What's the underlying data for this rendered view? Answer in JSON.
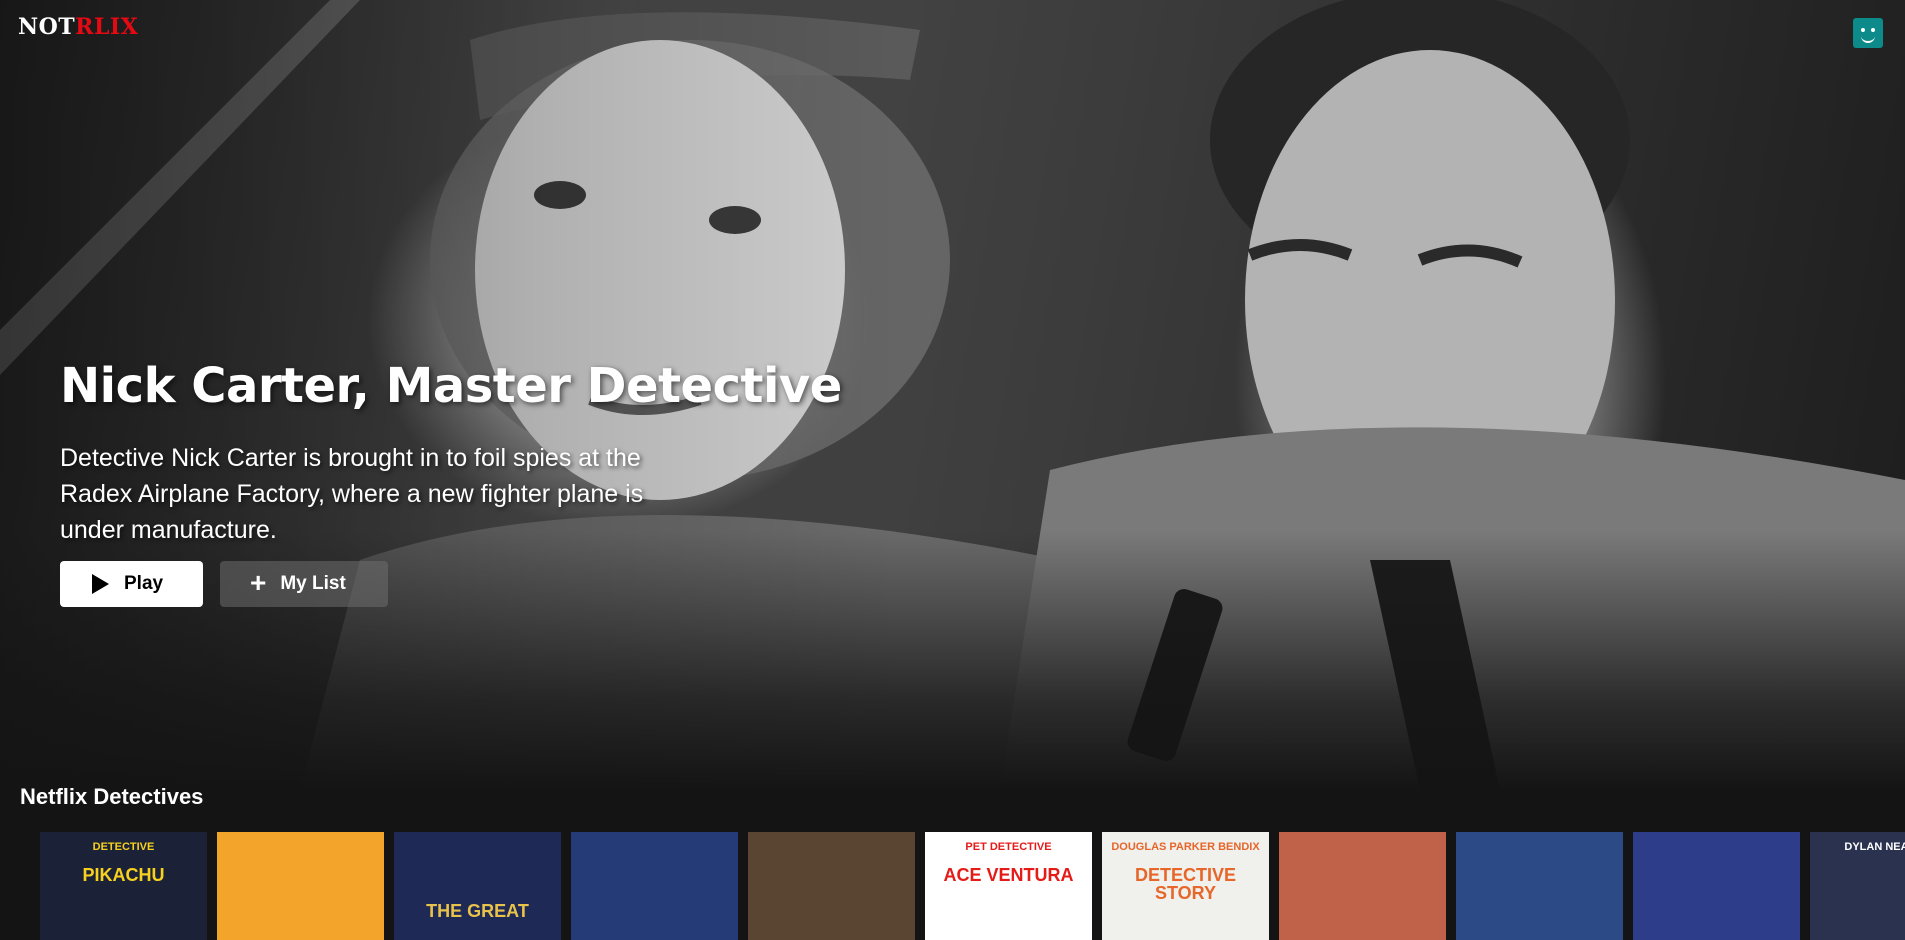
{
  "nav": {
    "logo_white": "NOT",
    "logo_red": "RLIX",
    "avatar_color": "#0d8a8a"
  },
  "hero": {
    "title": "Nick Carter, Master Detective",
    "description": "Detective Nick Carter is brought in to foil spies at the Radex Airplane Factory, where a new fighter plane is under manufacture.",
    "play_label": "Play",
    "mylist_label": "My List"
  },
  "row": {
    "title": "Netflix Detectives",
    "posters": [
      {
        "text": "PIKACHU",
        "sub": "DETECTIVE",
        "bg": "#1b2238",
        "fg": "#f7d11e"
      },
      {
        "text": "",
        "sub": "",
        "bg": "#f2a52a",
        "fg": "#222"
      },
      {
        "text": "THE GREAT",
        "sub": "",
        "bg": "#1e2a55",
        "fg": "#e8c24a"
      },
      {
        "text": "",
        "sub": "",
        "bg": "#243b78",
        "fg": "#fff"
      },
      {
        "text": "",
        "sub": "",
        "bg": "#5a4532",
        "fg": "#fff"
      },
      {
        "text": "ACE VENTURA",
        "sub": "PET DETECTIVE",
        "bg": "#ffffff",
        "fg": "#e41b17"
      },
      {
        "text": "DETECTIVE STORY",
        "sub": "DOUGLAS PARKER BENDIX",
        "bg": "#f0f0ec",
        "fg": "#e7662a"
      },
      {
        "text": "",
        "sub": "",
        "bg": "#c0614a",
        "fg": "#fff"
      },
      {
        "text": "",
        "sub": "",
        "bg": "#2b4a86",
        "fg": "#fff"
      },
      {
        "text": "",
        "sub": "",
        "bg": "#2d3d8a",
        "fg": "#fff"
      },
      {
        "text": "",
        "sub": "DYLAN NEAL  BRO",
        "bg": "#2a3250",
        "fg": "#fff"
      }
    ]
  }
}
